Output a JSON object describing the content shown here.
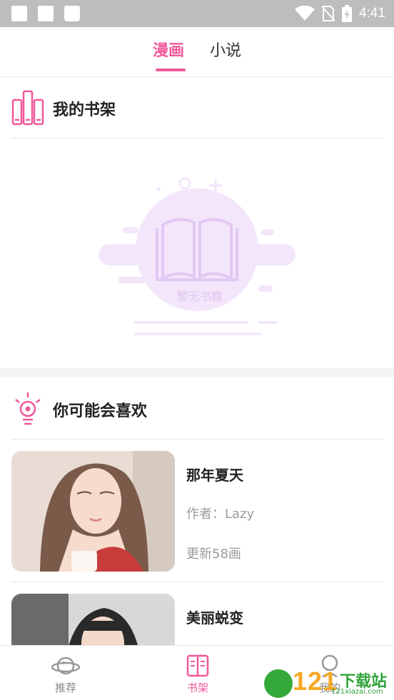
{
  "status_bar": {
    "time": "4:41"
  },
  "tabs": [
    {
      "label": "漫画",
      "active": true
    },
    {
      "label": "小说",
      "active": false
    }
  ],
  "shelf": {
    "title": "我的书架",
    "empty_text": "暂无书籍"
  },
  "recommend": {
    "title": "你可能会喜欢",
    "books": [
      {
        "title": "那年夏天",
        "author": "作者：Lazy",
        "updates": "更新58画"
      },
      {
        "title": "美丽蜕变"
      }
    ]
  },
  "bottom_nav": [
    {
      "label": "推荐",
      "icon": "planet-icon",
      "active": false
    },
    {
      "label": "书架",
      "icon": "book-icon",
      "active": true
    },
    {
      "label": "我的",
      "icon": "user-icon",
      "active": false
    }
  ],
  "watermark": {
    "number": "121",
    "text": "下载站",
    "url": "121xiazai.com"
  },
  "colors": {
    "accent": "#f0589a",
    "muted": "#9a9a9a",
    "illustration": "#f3e6fb"
  }
}
